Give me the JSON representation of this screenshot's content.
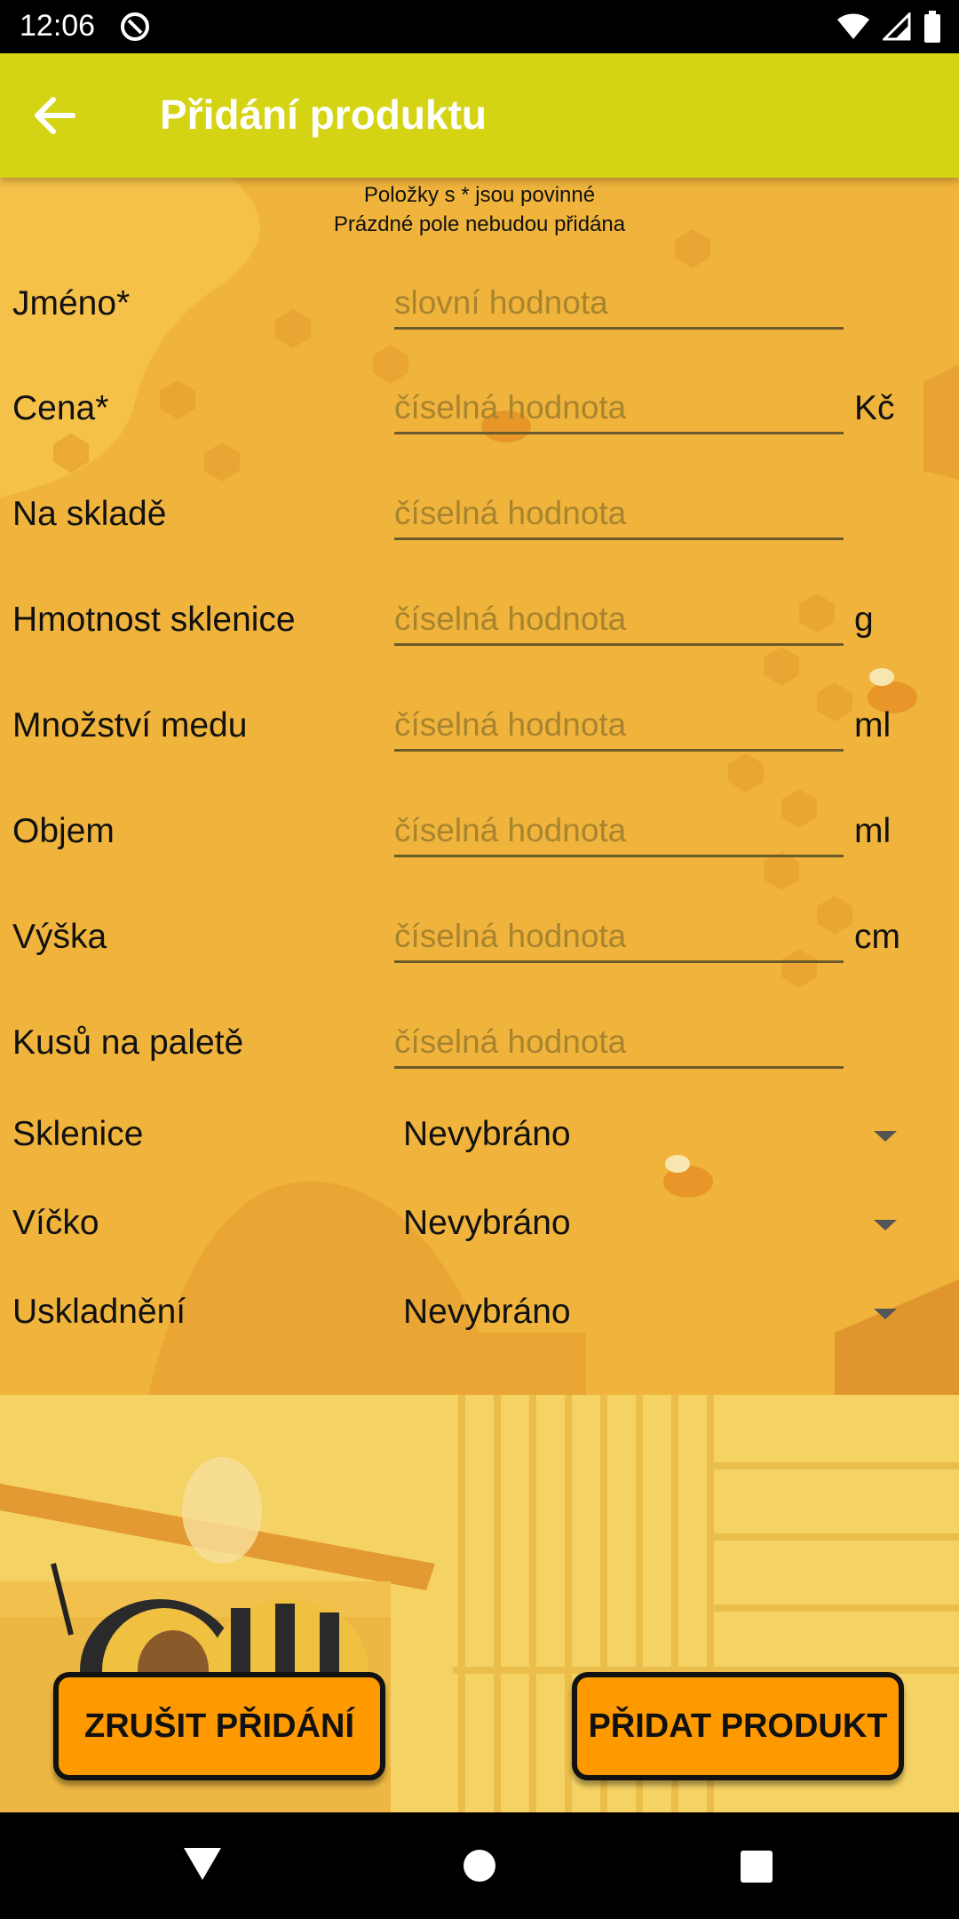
{
  "status_bar": {
    "time": "12:06"
  },
  "app_bar": {
    "title": "Přidání produktu"
  },
  "hints": {
    "line1": "Položky s * jsou povinné",
    "line2": "Prázdné pole nebudou přidána"
  },
  "fields": [
    {
      "label": "Jméno*",
      "placeholder": "slovní hodnota",
      "value": "",
      "unit": ""
    },
    {
      "label": "Cena*",
      "placeholder": "číselná hodnota",
      "value": "",
      "unit": "Kč"
    },
    {
      "label": "Na skladě",
      "placeholder": "číselná hodnota",
      "value": "",
      "unit": ""
    },
    {
      "label": "Hmotnost sklenice",
      "placeholder": "číselná hodnota",
      "value": "",
      "unit": "g"
    },
    {
      "label": "Množství medu",
      "placeholder": "číselná hodnota",
      "value": "",
      "unit": "ml"
    },
    {
      "label": "Objem",
      "placeholder": "číselná hodnota",
      "value": "",
      "unit": "ml"
    },
    {
      "label": "Výška",
      "placeholder": "číselná hodnota",
      "value": "",
      "unit": "cm"
    },
    {
      "label": "Kusů na paletě",
      "placeholder": "číselná hodnota",
      "value": "",
      "unit": ""
    }
  ],
  "spinners": [
    {
      "label": "Sklenice",
      "value": "Nevybráno"
    },
    {
      "label": "Víčko",
      "value": "Nevybráno"
    },
    {
      "label": "Uskladnění",
      "value": "Nevybráno"
    }
  ],
  "buttons": {
    "cancel": "ZRUŠIT PŘIDÁNÍ",
    "add": "PŘIDAT PRODUKT"
  },
  "colors": {
    "app_bar": "#d4d414",
    "background": "#f0b43c",
    "button": "#ff9900"
  }
}
